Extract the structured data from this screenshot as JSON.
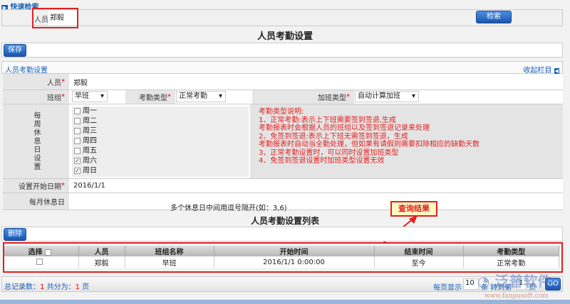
{
  "quick_search": {
    "title": "快速检索",
    "person_label": "人员",
    "person_value": "郑毅",
    "search_button": "检索"
  },
  "page_title": "人员考勤设置",
  "save_button": "保存",
  "section": {
    "title": "人员考勤设置",
    "collapse": "收起栏目"
  },
  "form": {
    "person_label": "人员",
    "person_value": "郑毅",
    "shift_label": "班组",
    "shift_value": "早班",
    "attendance_type_label": "考勤类型",
    "attendance_type_value": "正常考勤",
    "overtime_type_label": "加班类型",
    "overtime_type_value": "自动计算加班",
    "weekly_rest_label": "每周休息日设置",
    "weekdays": [
      {
        "label": "周一",
        "checked": false
      },
      {
        "label": "周二",
        "checked": false
      },
      {
        "label": "周三",
        "checked": false
      },
      {
        "label": "周四",
        "checked": false
      },
      {
        "label": "周五",
        "checked": false
      },
      {
        "label": "周六",
        "checked": true
      },
      {
        "label": "周日",
        "checked": true
      }
    ],
    "notes": [
      "考勤类型说明:",
      "1、正常考勤:表示上下班需要签到签退,生成",
      "考勤报表时会根据人员的班组以及签到签退记录来处理",
      "2、免签到签退:表示上下班无需签到签退，生成",
      "考勤报表时自动当全勤处理，但如果有请假则需要扣除相应的缺勤天数",
      "3、正常考勤设置时，可以同时设置加班类型",
      "4、免签到签退设置时加班类型设置无效"
    ],
    "start_date_label": "设置开始日期",
    "start_date_value": "2016/1/1",
    "monthly_rest_label": "每月休息日",
    "monthly_rest_hint": "多个休息日中间用逗号隔开(如：3,6)"
  },
  "callout": "查询结果",
  "list": {
    "title": "人员考勤设置列表",
    "delete_button": "删除",
    "columns": [
      "选择",
      "人员",
      "班组名称",
      "开始时间",
      "结束时间",
      "考勤类型"
    ],
    "rows": [
      {
        "person": "郑毅",
        "shift": "早班",
        "start": "2016/1/1 0:00:00",
        "end": "至今",
        "type": "正常考勤"
      }
    ]
  },
  "pager": {
    "total_label": "总记录数：",
    "total": "1",
    "pages_label": "共分为：",
    "pages": "1",
    "pages_unit": "页",
    "per_page_label": "每页显示",
    "per_page": "10",
    "per_page_unit": "条",
    "goto_label": "转到第",
    "goto_value": "1",
    "goto_unit": "页",
    "go": "GO"
  },
  "watermark": {
    "name": "泛普软件",
    "url": "www.fanpusoft.com"
  }
}
